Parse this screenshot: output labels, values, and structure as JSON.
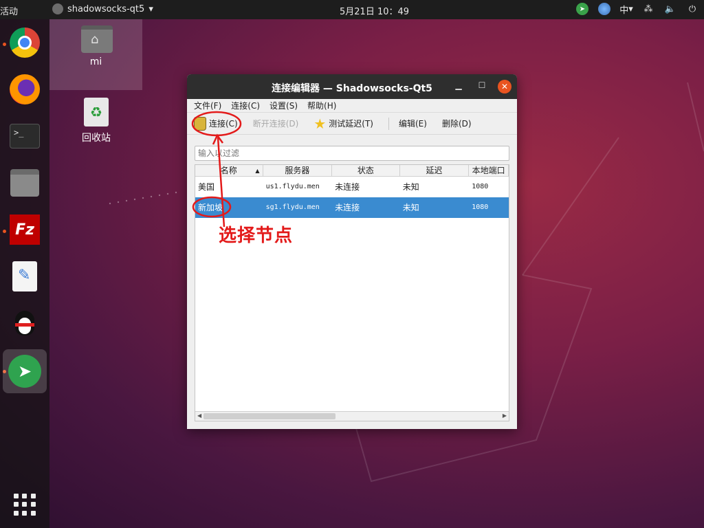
{
  "topbar": {
    "activities": "活动",
    "app_name": "shadowsocks-qt5",
    "clock": "5月21日 10：49",
    "ime": "中"
  },
  "desktop": {
    "home_label": "mi",
    "trash_label": "回收站"
  },
  "window": {
    "title": "连接编辑器 — Shadowsocks-Qt5",
    "menu": [
      "文件(F)",
      "连接(C)",
      "设置(S)",
      "帮助(H)"
    ],
    "toolbar": {
      "connect": "连接(C)",
      "disconnect": "断开连接(D)",
      "test_latency": "测试延迟(T)",
      "edit": "编辑(E)",
      "delete": "删除(D)"
    },
    "filter_placeholder": "输入以过滤",
    "columns": [
      "名称",
      "服务器",
      "状态",
      "延迟",
      "本地端口"
    ],
    "rows": [
      {
        "name": "美国",
        "server": "us1.flydu.men",
        "status": "未连接",
        "latency": "未知",
        "port": "1080",
        "selected": false
      },
      {
        "name": "新加坡",
        "server": "sg1.flydu.men",
        "status": "未连接",
        "latency": "未知",
        "port": "1080",
        "selected": true
      }
    ]
  },
  "annotation": {
    "text": "选择节点",
    "color": "#e31a1a"
  },
  "colors": {
    "accent": "#e95420",
    "selection": "#3a8bd0"
  }
}
